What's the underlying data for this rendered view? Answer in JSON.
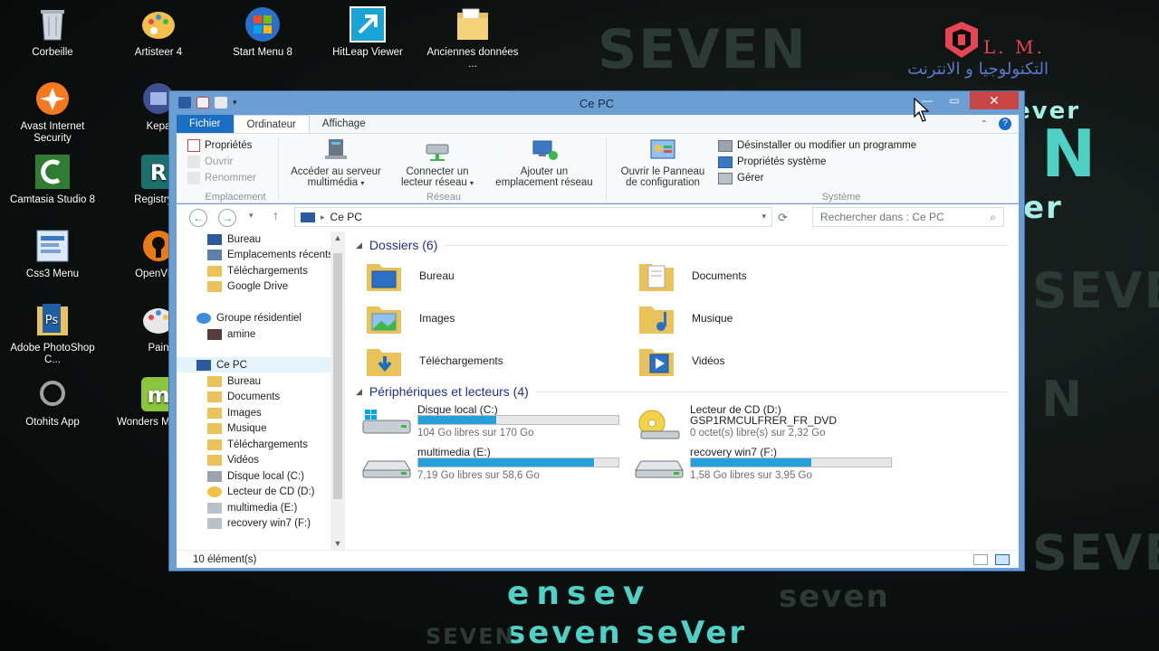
{
  "desktop": {
    "icons": [
      {
        "label": "Corbeille",
        "icon": "recycle-bin-icon"
      },
      {
        "label": "Artisteer 4",
        "icon": "palette-icon"
      },
      {
        "label": "Start Menu 8",
        "icon": "windows-logo-icon"
      },
      {
        "label": "HitLeap Viewer",
        "icon": "arrow-tile-icon"
      },
      {
        "label": "Anciennes données ...",
        "icon": "folder-icon"
      },
      {
        "label": "Avast Internet Security",
        "icon": "avast-icon"
      },
      {
        "label": "Kepa",
        "icon": "app-icon"
      },
      {
        "label": "Camtasia Studio 8",
        "icon": "camtasia-icon"
      },
      {
        "label": "Registry R",
        "icon": "registry-icon"
      },
      {
        "label": "Css3 Menu",
        "icon": "css-menu-icon"
      },
      {
        "label": "OpenVPN",
        "icon": "vpn-icon"
      },
      {
        "label": "Adobe PhotoShop C...",
        "icon": "photoshop-icon"
      },
      {
        "label": "Pain",
        "icon": "paint-icon"
      },
      {
        "label": "Otohits App",
        "icon": "otohits-icon"
      },
      {
        "label": "Wonders MobileG",
        "icon": "wondershare-icon"
      }
    ],
    "brand": {
      "letters": "L. M.",
      "arabic": "التكنولوجيا و الانترنت",
      "logo_color": "#e64553"
    }
  },
  "window": {
    "title": "Ce PC",
    "tabs": {
      "file": "Fichier",
      "computer": "Ordinateur",
      "view": "Affichage"
    },
    "ribbon": {
      "location": {
        "properties": "Propriétés",
        "open": "Ouvrir",
        "rename": "Renommer",
        "label": "Emplacement"
      },
      "network": {
        "media_server_1": "Accéder au serveur",
        "media_server_2": "multimédia",
        "map_drive_1": "Connecter un",
        "map_drive_2": "lecteur réseau",
        "add_location_1": "Ajouter un",
        "add_location_2": "emplacement réseau",
        "label": "Réseau"
      },
      "control_panel_1": "Ouvrir le Panneau",
      "control_panel_2": "de configuration",
      "system": {
        "uninstall": "Désinstaller ou modifier un programme",
        "sys_props": "Propriétés système",
        "manage": "Gérer",
        "label": "Système"
      }
    },
    "address": {
      "path": "Ce PC",
      "search_placeholder": "Rechercher dans : Ce PC"
    },
    "nav": [
      {
        "label": "Bureau",
        "indent": 1
      },
      {
        "label": "Emplacements récents",
        "indent": 1
      },
      {
        "label": "Téléchargements",
        "indent": 1
      },
      {
        "label": "Google Drive",
        "indent": 1
      },
      {
        "label": "Groupe résidentiel",
        "indent": 0
      },
      {
        "label": "amine",
        "indent": 1
      },
      {
        "label": "Ce PC",
        "indent": 0
      },
      {
        "label": "Bureau",
        "indent": 1
      },
      {
        "label": "Documents",
        "indent": 1
      },
      {
        "label": "Images",
        "indent": 1
      },
      {
        "label": "Musique",
        "indent": 1
      },
      {
        "label": "Téléchargements",
        "indent": 1
      },
      {
        "label": "Vidéos",
        "indent": 1
      },
      {
        "label": "Disque local (C:)",
        "indent": 1
      },
      {
        "label": "Lecteur de CD (D:)",
        "indent": 1
      },
      {
        "label": "multimedia (E:)",
        "indent": 1
      },
      {
        "label": "recovery win7 (F:)",
        "indent": 1
      }
    ],
    "folders_header": "Dossiers (6)",
    "folders": [
      {
        "name": "Bureau",
        "icon": "desktop-folder-icon"
      },
      {
        "name": "Documents",
        "icon": "documents-folder-icon"
      },
      {
        "name": "Images",
        "icon": "images-folder-icon"
      },
      {
        "name": "Musique",
        "icon": "music-folder-icon"
      },
      {
        "name": "Téléchargements",
        "icon": "downloads-folder-icon"
      },
      {
        "name": "Vidéos",
        "icon": "videos-folder-icon"
      }
    ],
    "devices_header": "Périphériques et lecteurs (4)",
    "drives": [
      {
        "name": "Disque local (C:)",
        "free": "104 Go libres sur 170 Go",
        "used_fraction": 0.388,
        "icon": "windows-drive-icon"
      },
      {
        "name": "Lecteur de CD (D:)",
        "name2": "GSP1RMCULFRER_FR_DVD",
        "free": "0 octet(s) libre(s) sur 2,32 Go",
        "icon": "cd-drive-icon"
      },
      {
        "name": "multimedia (E:)",
        "free": "7,19 Go libres sur 58,6 Go",
        "used_fraction": 0.877,
        "icon": "hard-drive-icon"
      },
      {
        "name": "recovery win7 (F:)",
        "free": "1,58 Go libres sur 3,95 Go",
        "used_fraction": 0.6,
        "icon": "hard-drive-icon"
      }
    ],
    "status": "10 élément(s)"
  },
  "colors": {
    "accent": "#1a6fc4",
    "bar_fill": "#26a0da",
    "close": "#c74545",
    "section_text": "#1e3287"
  }
}
